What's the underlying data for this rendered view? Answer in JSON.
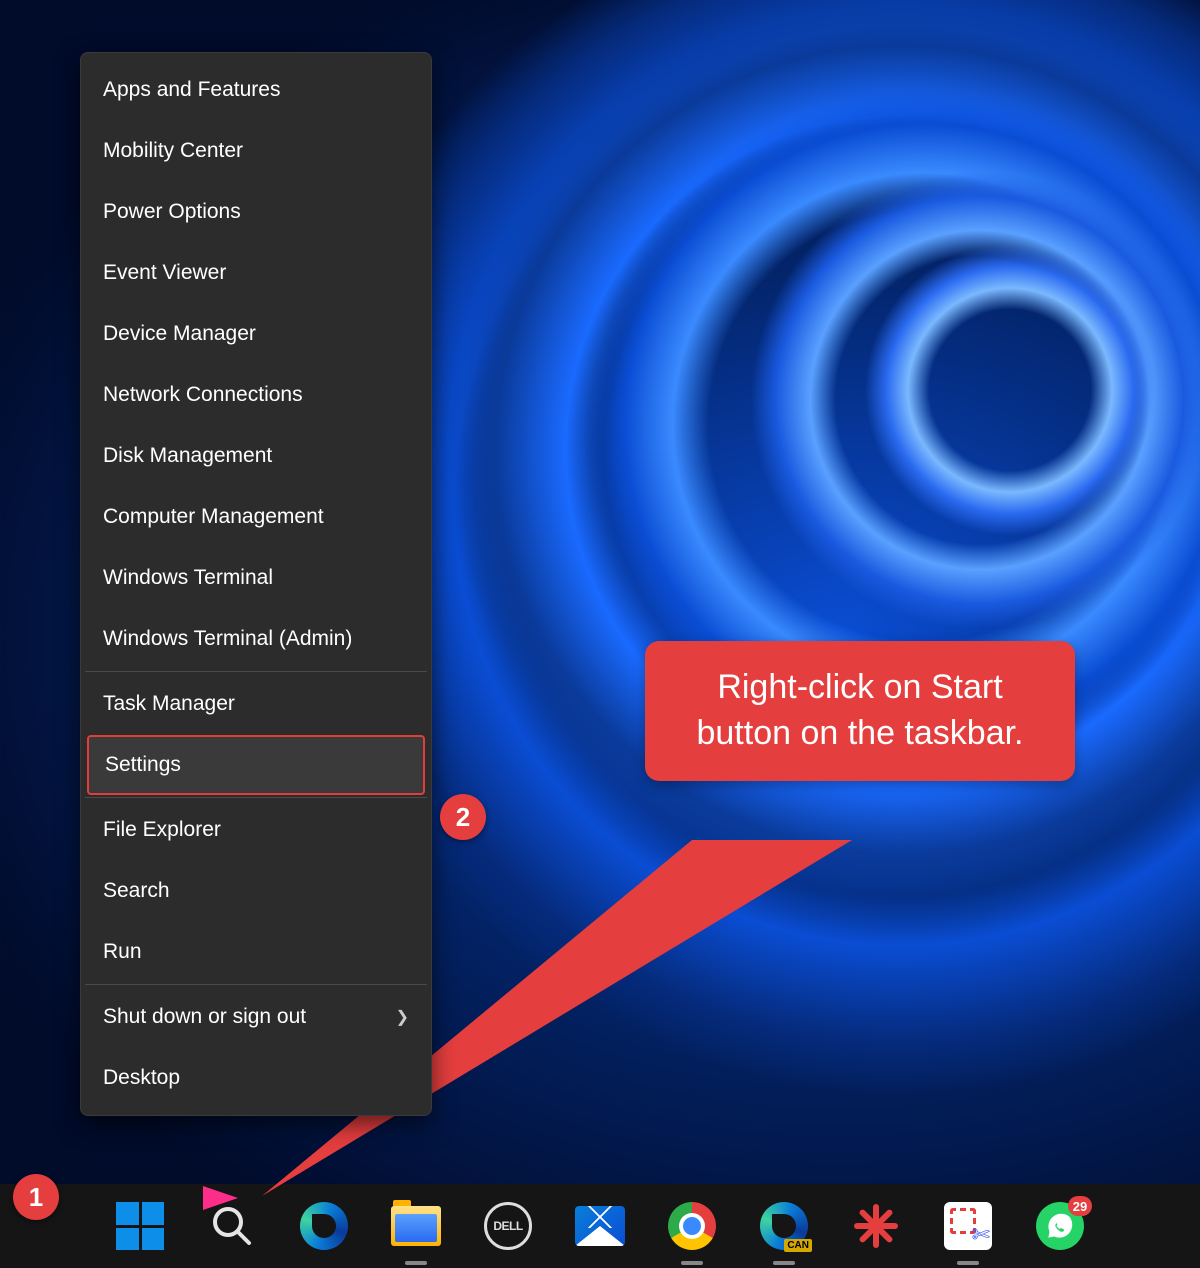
{
  "context_menu": {
    "items": [
      {
        "label": "Apps and Features",
        "has_submenu": false
      },
      {
        "label": "Mobility Center",
        "has_submenu": false
      },
      {
        "label": "Power Options",
        "has_submenu": false
      },
      {
        "label": "Event Viewer",
        "has_submenu": false
      },
      {
        "label": "Device Manager",
        "has_submenu": false
      },
      {
        "label": "Network Connections",
        "has_submenu": false
      },
      {
        "label": "Disk Management",
        "has_submenu": false
      },
      {
        "label": "Computer Management",
        "has_submenu": false
      },
      {
        "label": "Windows Terminal",
        "has_submenu": false
      },
      {
        "label": "Windows Terminal (Admin)",
        "has_submenu": false
      }
    ],
    "group2": [
      {
        "label": "Task Manager",
        "has_submenu": false
      },
      {
        "label": "Settings",
        "has_submenu": false,
        "highlighted": true
      }
    ],
    "group3": [
      {
        "label": "File Explorer",
        "has_submenu": false
      },
      {
        "label": "Search",
        "has_submenu": false
      },
      {
        "label": "Run",
        "has_submenu": false
      }
    ],
    "group4": [
      {
        "label": "Shut down or sign out",
        "has_submenu": true
      },
      {
        "label": "Desktop",
        "has_submenu": false
      }
    ]
  },
  "annotations": {
    "badge1": "1",
    "badge2": "2",
    "callout_text": "Right-click on Start button on the taskbar."
  },
  "taskbar": {
    "dell_label": "DELL",
    "edge_can_tag": "CAN",
    "whatsapp_badge": "29"
  },
  "colors": {
    "accent_red": "#e53e3e",
    "menu_bg": "#2c2c2c",
    "taskbar_bg": "#151515",
    "start_blue": "#0d8ee8"
  }
}
